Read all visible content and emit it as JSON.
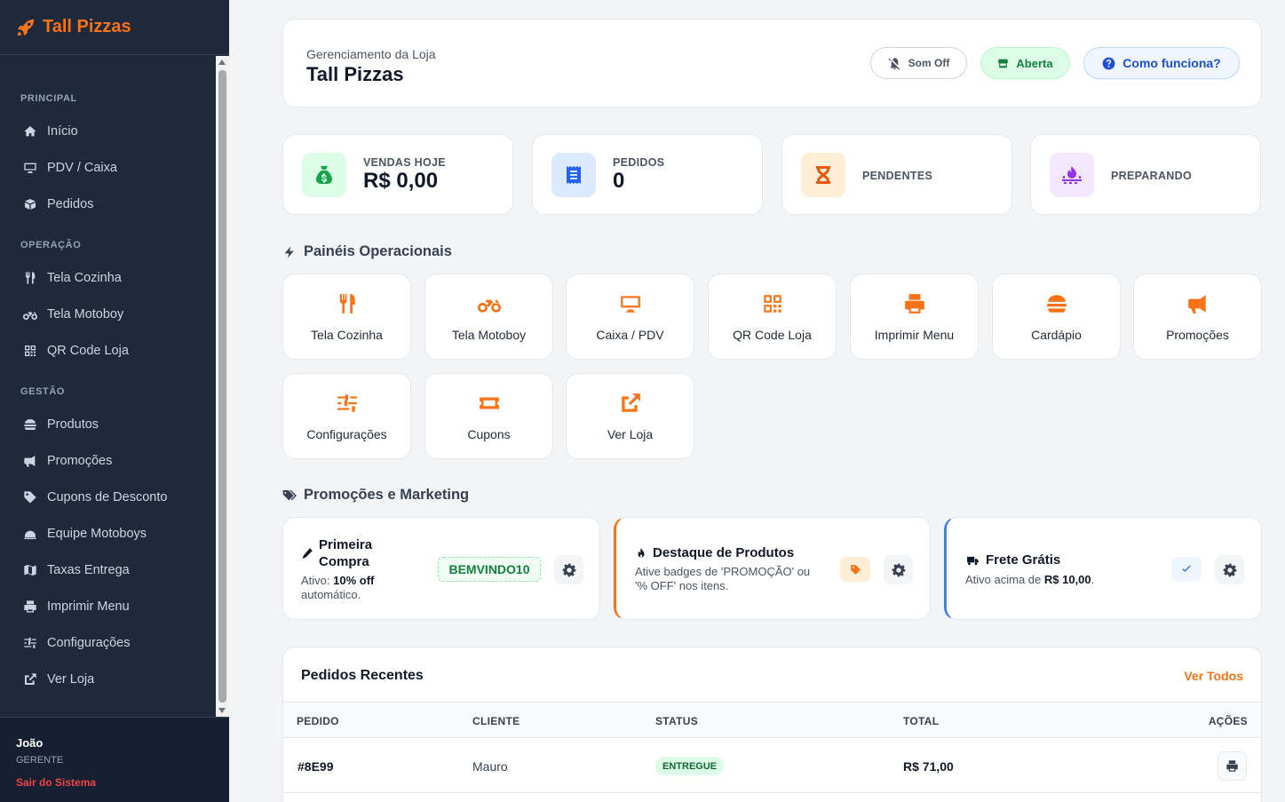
{
  "brand": {
    "name": "Tall Pizzas",
    "icon": "rocket-icon",
    "accent": "#f97316"
  },
  "sidebar": {
    "sections": [
      {
        "label": "PRINCIPAL",
        "items": [
          {
            "label": "Início",
            "icon": "home-icon"
          },
          {
            "label": "PDV / Caixa",
            "icon": "monitor-icon"
          },
          {
            "label": "Pedidos",
            "icon": "box-icon"
          }
        ]
      },
      {
        "label": "OPERAÇÃO",
        "items": [
          {
            "label": "Tela Cozinha",
            "icon": "utensils-icon"
          },
          {
            "label": "Tela Motoboy",
            "icon": "motorcycle-icon"
          },
          {
            "label": "QR Code Loja",
            "icon": "qrcode-icon"
          }
        ]
      },
      {
        "label": "GESTÃO",
        "items": [
          {
            "label": "Produtos",
            "icon": "burger-icon"
          },
          {
            "label": "Promoções",
            "icon": "megaphone-icon"
          },
          {
            "label": "Cupons de Desconto",
            "icon": "tag-icon"
          },
          {
            "label": "Equipe Motoboys",
            "icon": "helmet-icon"
          },
          {
            "label": "Taxas Entrega",
            "icon": "map-icon"
          },
          {
            "label": "Imprimir Menu",
            "icon": "printer-icon"
          },
          {
            "label": "Configurações",
            "icon": "sliders-icon"
          },
          {
            "label": "Ver Loja",
            "icon": "external-link-icon"
          }
        ]
      }
    ]
  },
  "user": {
    "name": "João",
    "role": "GERENTE",
    "logout": "Sair do Sistema"
  },
  "header": {
    "subtitle": "Gerenciamento da Loja",
    "title": "Tall Pizzas",
    "sound": "Som Off",
    "status": "Aberta",
    "help": "Como funciona?"
  },
  "stats": [
    {
      "label": "VENDAS HOJE",
      "value": "R$ 0,00",
      "icon": "money-bag-icon",
      "color": "#16a34a",
      "bg": "#dcfce7"
    },
    {
      "label": "PEDIDOS",
      "value": "0",
      "icon": "receipt-icon",
      "color": "#2563eb",
      "bg": "#dbeafe"
    },
    {
      "label": "PENDENTES",
      "value": "",
      "icon": "hourglass-icon",
      "color": "#ea580c",
      "bg": "#ffedd5"
    },
    {
      "label": "PREPARANDO",
      "value": "",
      "icon": "fire-burner-icon",
      "color": "#9333ea",
      "bg": "#f3e8ff"
    }
  ],
  "panels": {
    "title": "Painéis Operacionais",
    "tiles": [
      {
        "label": "Tela Cozinha",
        "icon": "utensils-icon"
      },
      {
        "label": "Tela Motoboy",
        "icon": "motorcycle-icon"
      },
      {
        "label": "Caixa / PDV",
        "icon": "monitor-icon"
      },
      {
        "label": "QR Code Loja",
        "icon": "qrcode-icon"
      },
      {
        "label": "Imprimir Menu",
        "icon": "printer-icon"
      },
      {
        "label": "Cardápio",
        "icon": "burger-icon"
      },
      {
        "label": "Promoções",
        "icon": "megaphone-icon"
      },
      {
        "label": "Configurações",
        "icon": "sliders-icon"
      },
      {
        "label": "Cupons",
        "icon": "ticket-icon"
      },
      {
        "label": "Ver Loja",
        "icon": "external-link-icon"
      }
    ]
  },
  "marketing": {
    "title": "Promoções e Marketing",
    "first": {
      "title_line1": "Primeira",
      "title_line2": "Compra",
      "desc_prefix": "Ativo: ",
      "desc_bold": "10% off",
      "desc_suffix": "automático.",
      "code": "BEMVINDO10"
    },
    "highlight": {
      "title": "Destaque de Produtos",
      "desc_line1": "Ative badges de 'PROMOÇÃO' ou",
      "desc_line2": "'% OFF' nos itens."
    },
    "shipping": {
      "title": "Frete Grátis",
      "desc_prefix": "Ativo acima de ",
      "desc_bold": "R$ 10,00",
      "desc_suffix": "."
    }
  },
  "orders": {
    "title": "Pedidos Recentes",
    "view_all": "Ver Todos",
    "columns": [
      "PEDIDO",
      "CLIENTE",
      "STATUS",
      "TOTAL",
      "AÇÕES"
    ],
    "rows": [
      {
        "id": "#8E99",
        "client": "Mauro",
        "status": "ENTREGUE",
        "total": "R$ 71,00"
      }
    ]
  }
}
